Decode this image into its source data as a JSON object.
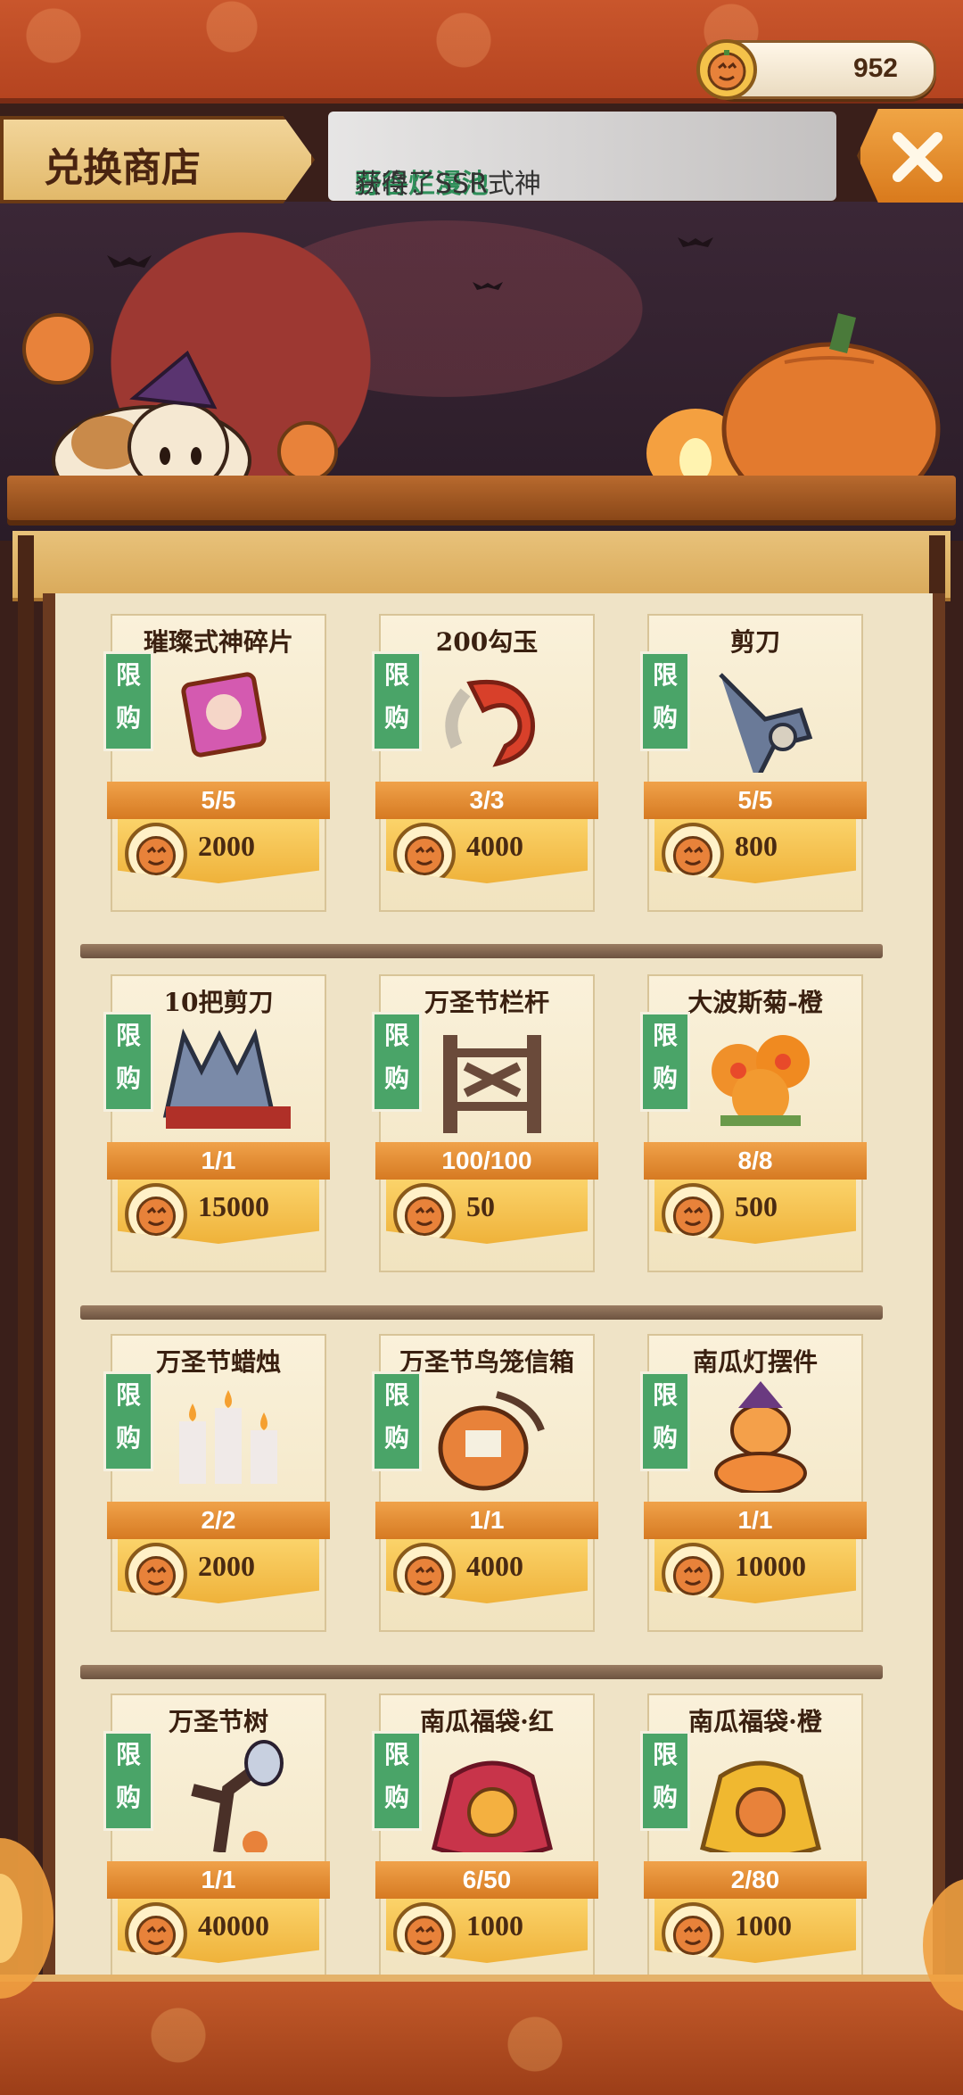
{
  "header": {
    "currency_amount": "952",
    "currency_icon": "pumpkin-coin-icon",
    "title": "兑换商店",
    "notice_prefix": "召唤！",
    "notice_highlight": "野谷烂漫池",
    "notice_suffix": "获得了SSR式神",
    "close_icon": "close-x-icon"
  },
  "limited_tag": "限购",
  "items": [
    {
      "name": "璀璨式神碎片",
      "stock": "5/5",
      "price": "2000",
      "icon": "shikigami-shard-icon"
    },
    {
      "name": "200勾玉",
      "stock": "3/3",
      "price": "4000",
      "icon": "magatama-icon"
    },
    {
      "name": "剪刀",
      "stock": "5/5",
      "price": "800",
      "icon": "scissors-icon"
    },
    {
      "name": "10把剪刀",
      "stock": "1/1",
      "price": "15000",
      "icon": "scissors-bundle-icon"
    },
    {
      "name": "万圣节栏杆",
      "stock": "100/100",
      "price": "50",
      "icon": "fence-icon"
    },
    {
      "name": "大波斯菊-橙",
      "stock": "8/8",
      "price": "500",
      "icon": "flower-icon"
    },
    {
      "name": "万圣节蜡烛",
      "stock": "2/2",
      "price": "2000",
      "icon": "candles-icon"
    },
    {
      "name": "万圣节鸟笼信箱",
      "stock": "1/1",
      "price": "4000",
      "icon": "mailbox-icon"
    },
    {
      "name": "南瓜灯摆件",
      "stock": "1/1",
      "price": "10000",
      "icon": "pumpkin-ornament-icon"
    },
    {
      "name": "万圣节树",
      "stock": "1/1",
      "price": "40000",
      "icon": "halloween-tree-icon"
    },
    {
      "name": "南瓜福袋·红",
      "stock": "6/50",
      "price": "1000",
      "icon": "red-lucky-bag-icon"
    },
    {
      "name": "南瓜福袋·橙",
      "stock": "2/80",
      "price": "1000",
      "icon": "orange-lucky-bag-icon"
    }
  ]
}
